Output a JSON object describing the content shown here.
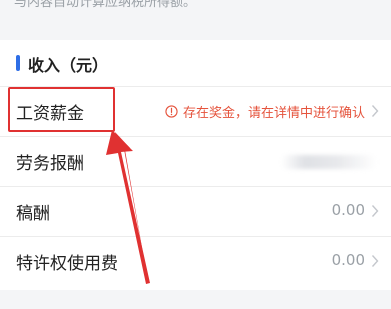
{
  "top_note": "与内容自动计算应纳税所得额。",
  "section": {
    "title": "收入（元）"
  },
  "rows": [
    {
      "label": "工资薪金",
      "warning": "存在奖金，请在详情中进行确认"
    },
    {
      "label": "劳务报酬"
    },
    {
      "label": "稿酬",
      "value": "0.00"
    },
    {
      "label": "特许权使用费",
      "value": "0.00"
    }
  ],
  "colors": {
    "accent": "#2e6ee6",
    "warning": "#e5533c",
    "annotation": "#e03131"
  },
  "icons": [
    "warning-circle-icon",
    "chevron-right-icon"
  ]
}
